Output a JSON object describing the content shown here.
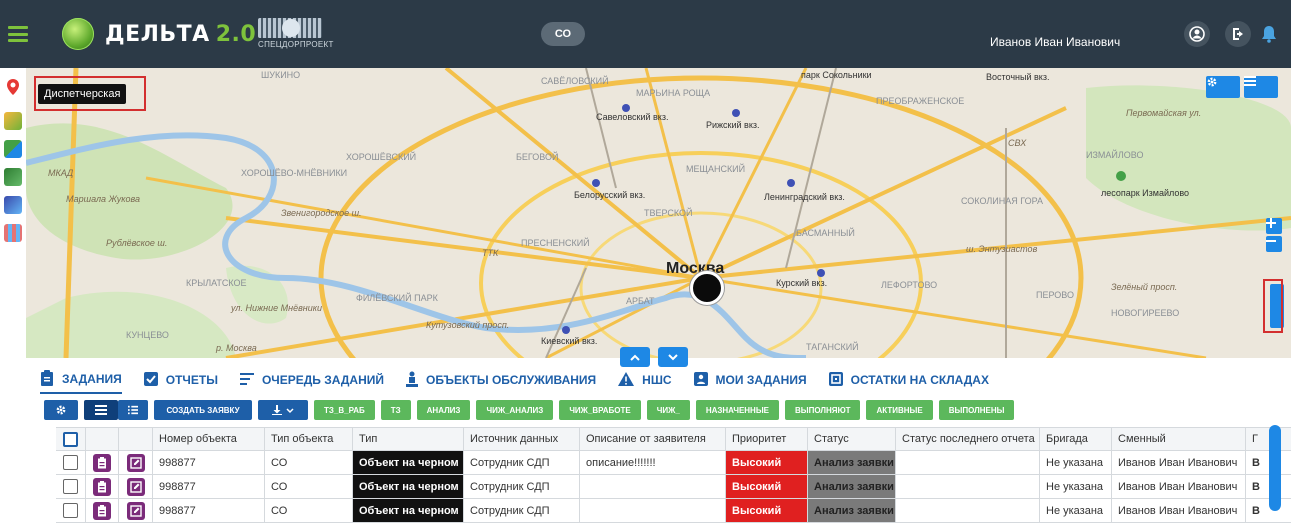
{
  "header": {
    "logo_text": "ДЕЛЬТА",
    "logo_version": "2.0",
    "partner_name": "СПЕЦДОРПРОЕКТ",
    "org_badge": "СО",
    "user_name": "Иванов Иван Иванович"
  },
  "map": {
    "tooltip": "Диспетчерская",
    "city": "Москва",
    "labels": [
      {
        "text": "ШУКИНО",
        "kind": "district"
      },
      {
        "text": "САВЁЛОВСКИЙ",
        "kind": "district"
      },
      {
        "text": "МАРЬИНА РОЩА",
        "kind": "district"
      },
      {
        "text": "парк Сокольники",
        "kind": "place"
      },
      {
        "text": "Восточный вкз.",
        "kind": "place"
      },
      {
        "text": "ПРЕОБРАЖЕНСКОЕ",
        "kind": "district"
      },
      {
        "text": "Савеловский вкз.",
        "kind": "place"
      },
      {
        "text": "Рижский вкз.",
        "kind": "place"
      },
      {
        "text": "ХОРОШЁВСКИЙ",
        "kind": "district"
      },
      {
        "text": "БЕГОВОЙ",
        "kind": "district"
      },
      {
        "text": "ХОРОШЁВО-МНЁВНИКИ",
        "kind": "district"
      },
      {
        "text": "МЕЩАНСКИЙ",
        "kind": "district"
      },
      {
        "text": "ИЗМАЙЛОВО",
        "kind": "district"
      },
      {
        "text": "Маршала Жукова",
        "kind": "road"
      },
      {
        "text": "Белорусский вкз.",
        "kind": "place"
      },
      {
        "text": "ТВЕРСКОЙ",
        "kind": "district"
      },
      {
        "text": "Ленинградский вкз.",
        "kind": "place"
      },
      {
        "text": "СОКОЛИНАЯ ГОРА",
        "kind": "district"
      },
      {
        "text": "лесопарк Измайлово",
        "kind": "place"
      },
      {
        "text": "Звенигородское ш.",
        "kind": "road"
      },
      {
        "text": "БАСМАННЫЙ",
        "kind": "district"
      },
      {
        "text": "ПРЕСНЕНСКИЙ",
        "kind": "district"
      },
      {
        "text": "ш. Энтузиастов",
        "kind": "road"
      },
      {
        "text": "КРЫЛАТСКОЕ",
        "kind": "district"
      },
      {
        "text": "АРБАТ",
        "kind": "district"
      },
      {
        "text": "Курский вкз.",
        "kind": "place"
      },
      {
        "text": "ЛЕФОРТОВО",
        "kind": "district"
      },
      {
        "text": "ПЕРОВО",
        "kind": "district"
      },
      {
        "text": "ФИЛЁВСКИЙ ПАРК",
        "kind": "district"
      },
      {
        "text": "НОВОГИРЕЕВО",
        "kind": "district"
      },
      {
        "text": "Киевский вкз.",
        "kind": "place"
      },
      {
        "text": "КУНЦЕВО",
        "kind": "district"
      },
      {
        "text": "ТАГАНСКИЙ",
        "kind": "district"
      },
      {
        "text": "ул. Нижние Мнёвники",
        "kind": "road"
      },
      {
        "text": "Кутузовский просп.",
        "kind": "road"
      },
      {
        "text": "Рублёвское ш.",
        "kind": "road"
      },
      {
        "text": "р. Москва",
        "kind": "road"
      },
      {
        "text": "Первомайская ул.",
        "kind": "road"
      },
      {
        "text": "Зелёный просп.",
        "kind": "road"
      },
      {
        "text": "МКАД",
        "kind": "road"
      },
      {
        "text": "ТТК",
        "kind": "road"
      },
      {
        "text": "СВХ",
        "kind": "road"
      }
    ]
  },
  "tabs": [
    {
      "label": "ЗАДАНИЯ",
      "icon": "clipboard-icon"
    },
    {
      "label": "ОТЧЕТЫ",
      "icon": "check-square-icon"
    },
    {
      "label": "ОЧЕРЕДЬ ЗАДАНИЙ",
      "icon": "list-icon"
    },
    {
      "label": "ОБЪЕКТЫ ОБСЛУЖИВАНИЯ",
      "icon": "person-icon"
    },
    {
      "label": "НШС",
      "icon": "warning-icon"
    },
    {
      "label": "МОИ ЗАДАНИЯ",
      "icon": "user-badge-icon"
    },
    {
      "label": "ОСТАТКИ НА СКЛАДАХ",
      "icon": "warehouse-icon"
    }
  ],
  "toolbar": {
    "create_label": "СОЗДАТЬ ЗАЯВКУ",
    "filters": [
      "ТЗ_В_РАБ",
      "ТЗ",
      "АНАЛИЗ",
      "ЧИЖ_АНАЛИЗ",
      "ЧИЖ_ВРАБОТЕ",
      "ЧИЖ_",
      "НАЗНАЧЕННЫЕ",
      "ВЫПОЛНЯЮТ",
      "АКТИВНЫЕ",
      "ВЫПОЛНЕНЫ"
    ]
  },
  "table": {
    "columns": [
      "Номер объекта",
      "Тип объекта",
      "Тип",
      "Источник данных",
      "Описание от заявителя",
      "Приоритет",
      "Статус",
      "Статус последнего отчета",
      "Бригада",
      "Сменный",
      "Г"
    ],
    "rows": [
      {
        "number": "998877",
        "obj_type": "СО",
        "type": "Объект на черном",
        "source": "Сотрудник СДП",
        "description": "описание!!!!!!!",
        "priority": "Высокий",
        "status": "Анализ заявки",
        "last_report": "",
        "brigade": "Не указана",
        "shift": "Иванов Иван Иванович",
        "extra": "В"
      },
      {
        "number": "998877",
        "obj_type": "СО",
        "type": "Объект на черном",
        "source": "Сотрудник СДП",
        "description": "",
        "priority": "Высокий",
        "status": "Анализ заявки",
        "last_report": "",
        "brigade": "Не указана",
        "shift": "Иванов Иван Иванович",
        "extra": "В"
      },
      {
        "number": "998877",
        "obj_type": "СО",
        "type": "Объект на черном",
        "source": "Сотрудник СДП",
        "description": "",
        "priority": "Высокий",
        "status": "Анализ заявки",
        "last_report": "",
        "brigade": "Не указана",
        "shift": "Иванов Иван Иванович",
        "extra": "В"
      }
    ]
  },
  "colors": {
    "header_bg": "#2c3a47",
    "accent_green": "#7ec23c",
    "primary_blue": "#1e5fa8",
    "filter_green": "#5cb85c",
    "priority_red": "#e02020",
    "status_gray": "#7a7a7a"
  }
}
